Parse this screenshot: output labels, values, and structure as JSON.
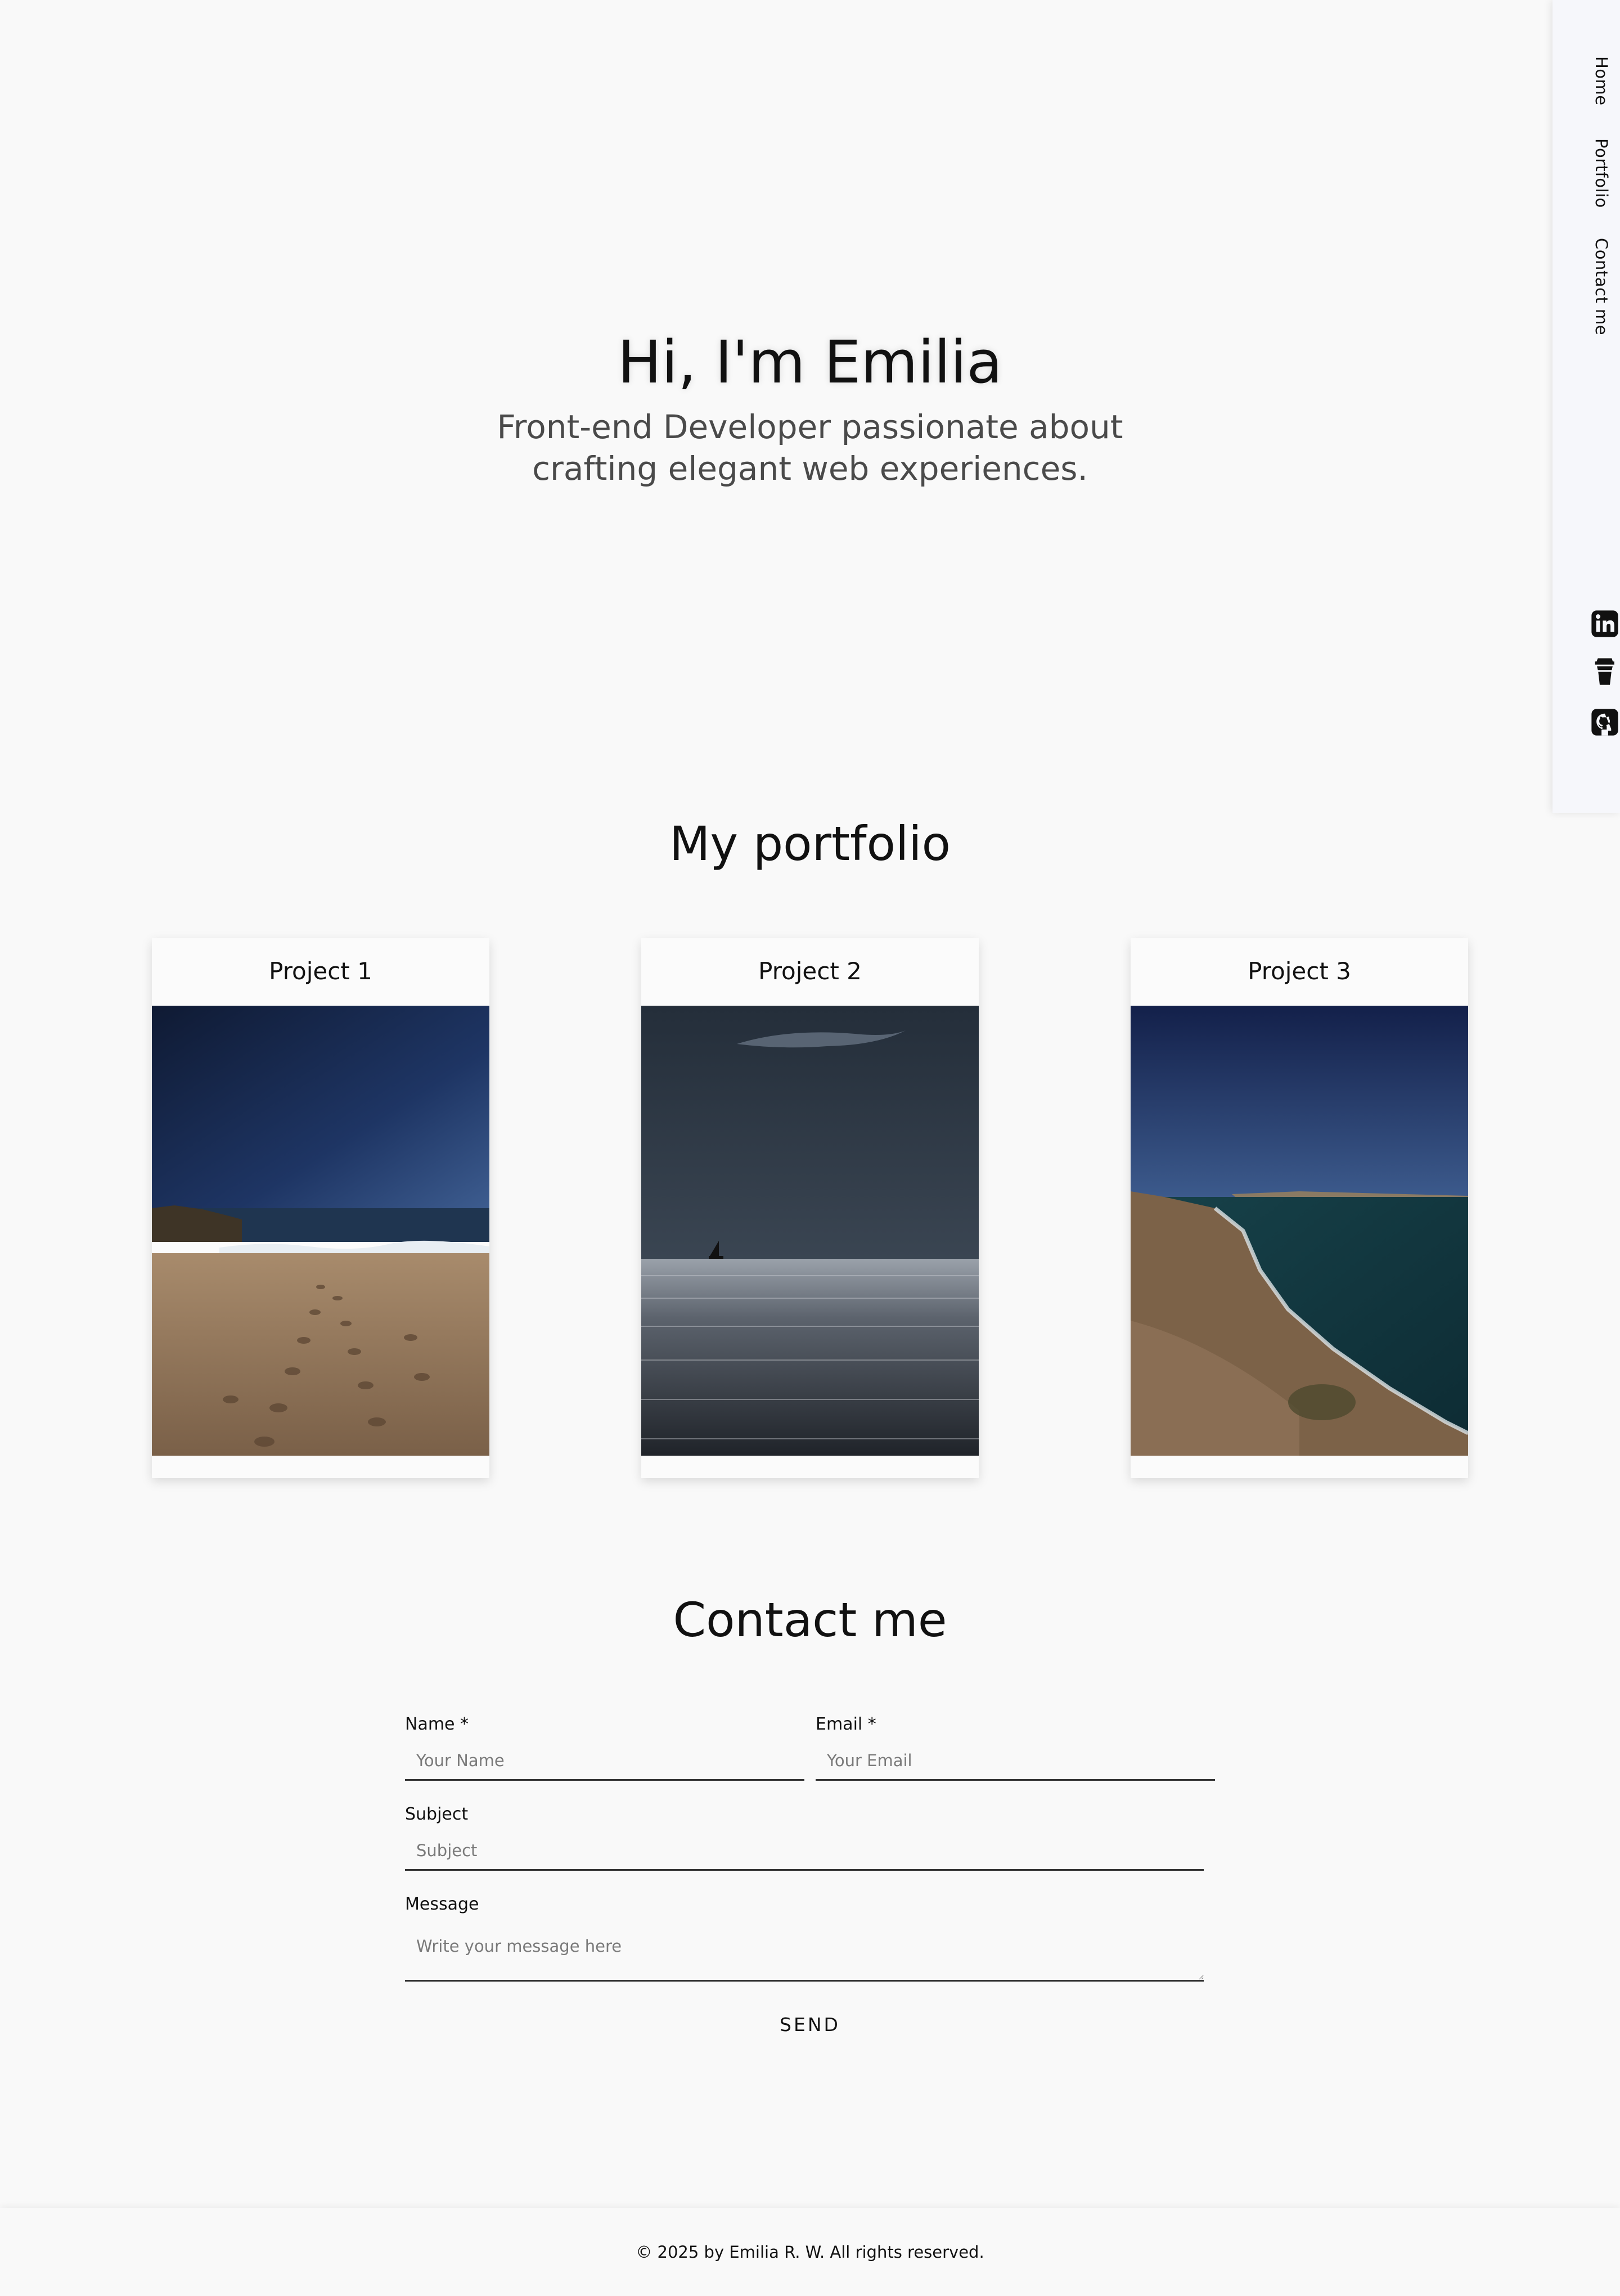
{
  "nav": {
    "home": "Home",
    "portfolio": "Portfolio",
    "contact": "Contact me"
  },
  "social": [
    "linkedin-icon",
    "coffee-cup-icon",
    "github-icon"
  ],
  "hero": {
    "title": "Hi, I'm Emilia",
    "subtitle": "Front-end Developer passionate about crafting elegant web experiences."
  },
  "portfolio": {
    "title": "My portfolio",
    "projects": [
      {
        "title": "Project 1",
        "image": "beach-footprints-photo"
      },
      {
        "title": "Project 2",
        "image": "sailboat-sea-photo"
      },
      {
        "title": "Project 3",
        "image": "coastal-cliffs-photo"
      }
    ]
  },
  "contact": {
    "title": "Contact me",
    "name_label": "Name *",
    "name_placeholder": "Your Name",
    "email_label": "Email *",
    "email_placeholder": "Your Email",
    "subject_label": "Subject",
    "subject_placeholder": "Subject",
    "message_label": "Message",
    "message_placeholder": "Write your message here",
    "send_label": "SEND"
  },
  "footer": {
    "text": "© 2025 by Emilia R. W. All rights reserved."
  },
  "colors": {
    "background": "#f9f9f9",
    "sidebar": "#f6f7fb",
    "text": "#111111",
    "subtitle": "#4a4a4a"
  }
}
